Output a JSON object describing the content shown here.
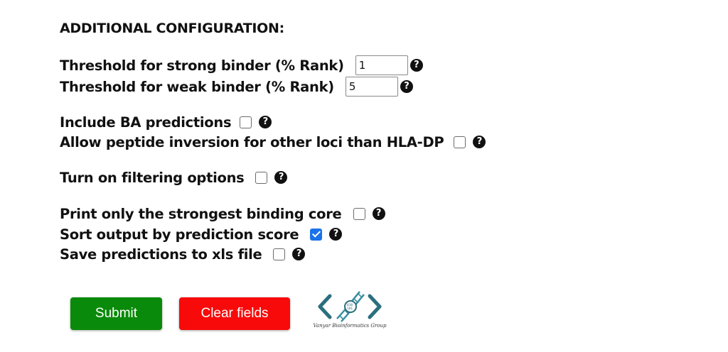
{
  "section_heading": "ADDITIONAL CONFIGURATION:",
  "thresholds": {
    "strong": {
      "label": "Threshold for strong binder (% Rank)",
      "value": "1"
    },
    "weak": {
      "label": "Threshold for weak binder (% Rank)",
      "value": "5"
    }
  },
  "options": {
    "include_ba": {
      "label": "Include BA predictions",
      "checked": false
    },
    "peptide_inversion": {
      "label": "Allow peptide inversion for other loci than HLA-DP",
      "checked": false
    },
    "filtering": {
      "label": "Turn on filtering options",
      "checked": false
    },
    "strongest_core": {
      "label": "Print only the strongest binding core",
      "checked": false
    },
    "sort_output": {
      "label": "Sort output by prediction score",
      "checked": true
    },
    "save_xls": {
      "label": "Save predictions to xls file",
      "checked": false
    }
  },
  "help_icon_glyph": "?",
  "buttons": {
    "submit": "Submit",
    "clear": "Clear fields"
  },
  "logo": {
    "text": "Vanyar Bioinformatics Group",
    "color": "#2b6f7e",
    "icon": "dna-code-brackets-logo"
  },
  "colors": {
    "submit": "#0a8a0a",
    "clear": "#f80a0a",
    "checkbox_checked": "#1a73e8"
  }
}
